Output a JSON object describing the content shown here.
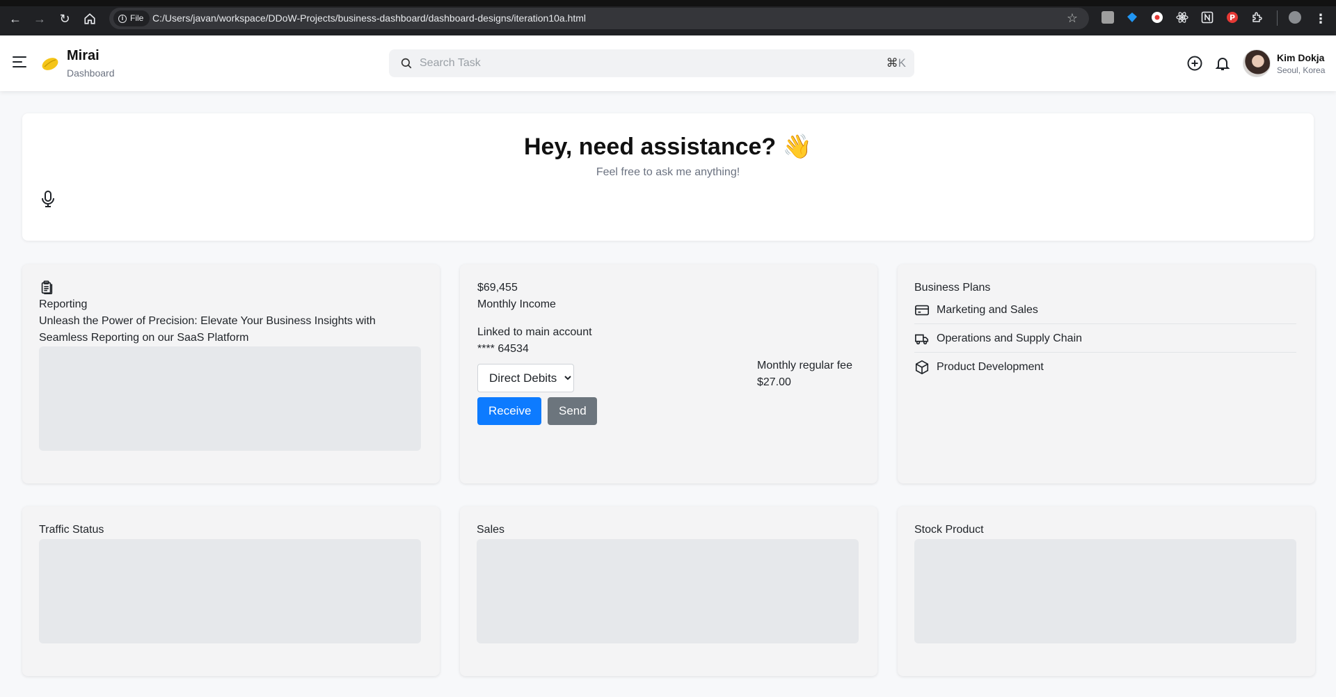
{
  "browser": {
    "chip_label": "File",
    "url": "C:/Users/javan/workspace/DDoW-Projects/business-dashboard/dashboard-designs/iteration10a.html",
    "extension_colors": [
      "#9e9e9e",
      "#2196f3",
      "#ffffff",
      "#e8eaed",
      "#e8eaed",
      "#e53935",
      "#e8eaed"
    ]
  },
  "header": {
    "brand_title": "Mirai",
    "brand_subtitle": "Dashboard",
    "search_placeholder": "Search Task",
    "shortcut_symbol": "⌘",
    "shortcut_key": "K",
    "user_name": "Kim Dokja",
    "user_location": "Seoul, Korea",
    "accent": "#f5c518"
  },
  "assist": {
    "heading": "Hey, need assistance?",
    "emoji": "👋",
    "subtext": "Feel free to ask me anything!"
  },
  "reporting": {
    "title": "Reporting",
    "description": "Unleash the Power of Precision: Elevate Your Business Insights with Seamless Reporting on our SaaS Platform"
  },
  "income": {
    "amount": "$69,455",
    "label": "Monthly Income",
    "linked_label": "Linked to main account",
    "account_mask": "**** 64534",
    "select_selected": "Direct Debits",
    "fee_label": "Monthly regular fee",
    "fee_value": "$27.00",
    "receive_label": "Receive",
    "send_label": "Send"
  },
  "plans": {
    "title": "Business Plans",
    "items": [
      {
        "label": "Marketing and Sales",
        "icon": "credit-card-icon"
      },
      {
        "label": "Operations and Supply Chain",
        "icon": "truck-icon"
      },
      {
        "label": "Product Development",
        "icon": "box-icon"
      }
    ]
  },
  "widgets": {
    "traffic_title": "Traffic Status",
    "sales_title": "Sales",
    "stock_title": "Stock Product"
  }
}
